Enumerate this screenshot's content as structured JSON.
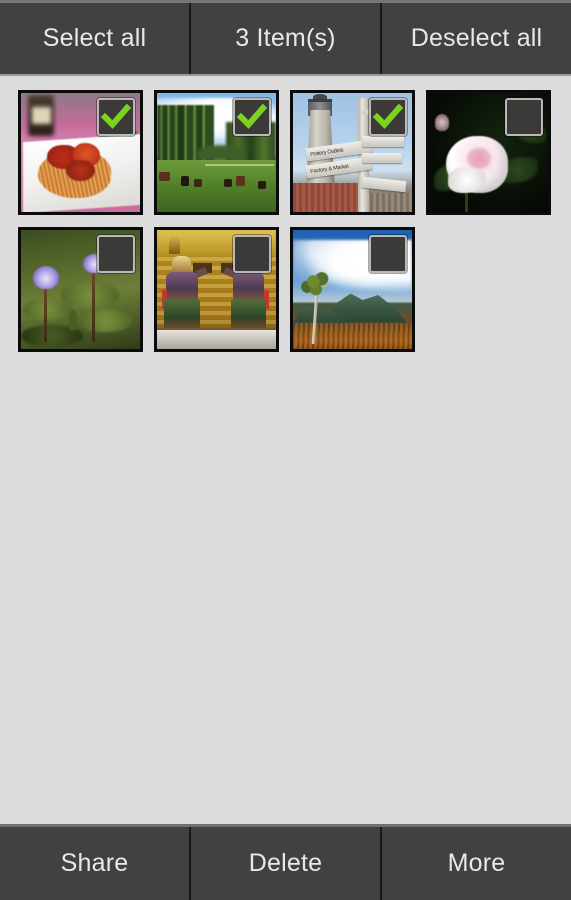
{
  "top_bar": {
    "buttons": [
      {
        "id": "select-all",
        "label": "Select all"
      },
      {
        "id": "item-count",
        "label": "3 Item(s)"
      },
      {
        "id": "deselect-all",
        "label": "Deselect all"
      }
    ]
  },
  "bottom_bar": {
    "buttons": [
      {
        "id": "share",
        "label": "Share"
      },
      {
        "id": "delete",
        "label": "Delete"
      },
      {
        "id": "more",
        "label": "More"
      }
    ]
  },
  "gallery": {
    "selected_count": 3,
    "total_count": 7,
    "columns": 4,
    "checkbox_icon_checked": "checkmark-icon",
    "checkbox_icon_unchecked": "empty-checkbox-icon",
    "checkmark_color": "#7ed321",
    "items": [
      {
        "id": "photo-1",
        "subject": "Plate of spaghetti with tomato sauce",
        "art": "art-pasta",
        "selected": true
      },
      {
        "id": "photo-2",
        "subject": "Horses grazing in a green pasture with birch trees",
        "art": "art-pasture",
        "selected": true
      },
      {
        "id": "photo-3",
        "subject": "Lighthouse tower with wooden signposts",
        "art": "art-lighthouse",
        "selected": true,
        "sign_labels": [
          "Pottery Outlets",
          "Factory & Market",
          "",
          "",
          ""
        ]
      },
      {
        "id": "photo-4",
        "subject": "White and pink rose with dew on dark foliage",
        "art": "art-rose",
        "selected": false
      },
      {
        "id": "photo-5",
        "subject": "Purple water lilies on lily pads",
        "art": "art-lily",
        "selected": false
      },
      {
        "id": "photo-6",
        "subject": "Thai temple guardian statues on golden wall",
        "art": "art-temple",
        "selected": false
      },
      {
        "id": "photo-7",
        "subject": "Mountain landscape with lone tree and clouds",
        "art": "art-mountain",
        "selected": false
      }
    ]
  },
  "colors": {
    "bar_background": "#414141",
    "bar_top_highlight": "#767676",
    "bar_text": "#e8e8e8",
    "bar_divider": "#191919",
    "content_background": "#dcdcdc",
    "thumb_border": "#0b0b0b",
    "checkbox_fill": "#3b3a39",
    "checkbox_border": "#b9b9b9",
    "accent_green": "#7ed321"
  }
}
